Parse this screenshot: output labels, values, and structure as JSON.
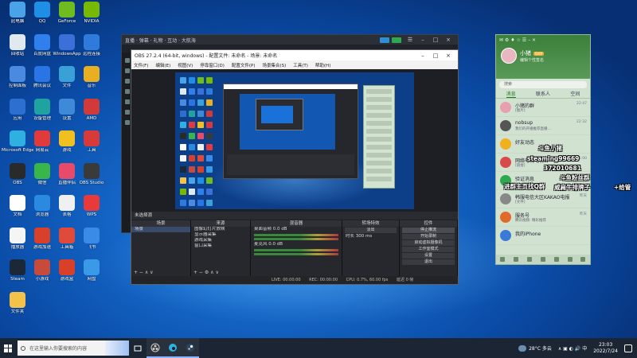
{
  "colors": {
    "accent": "#2fa84f",
    "desktop": "#1466c7",
    "taskbar": "#1c2533"
  },
  "desktop_icons": [
    {
      "label": "此电脑",
      "icon": "computer-icon",
      "color": "#4aa3e8"
    },
    {
      "label": "QQ",
      "icon": "qq-penguin-icon",
      "color": "#1f8fe6"
    },
    {
      "label": "GeForce",
      "icon": "geforce-icon",
      "color": "#6ebc1f"
    },
    {
      "label": "NVIDIA",
      "icon": "nvidia-icon",
      "color": "#76b900"
    },
    {
      "label": "回收站",
      "icon": "recycle-bin-icon",
      "color": "#e0e8f0"
    },
    {
      "label": "百度网盘",
      "icon": "baidu-netdisk-icon",
      "color": "#2f80ed"
    },
    {
      "label": "WindowsApp",
      "icon": "windows-app-icon",
      "color": "#3a70d8"
    },
    {
      "label": "远程连接",
      "icon": "remote-icon",
      "color": "#2e7bdc"
    },
    {
      "label": "控制面板",
      "icon": "control-panel-icon",
      "color": "#4a8ae0"
    },
    {
      "label": "腾讯会议",
      "icon": "tencent-meeting-icon",
      "color": "#2a75e5"
    },
    {
      "label": "文件",
      "icon": "file-icon",
      "color": "#3aa0d8"
    },
    {
      "label": "音乐",
      "icon": "music-icon",
      "color": "#e8b020"
    },
    {
      "label": "应用",
      "icon": "app-icon",
      "color": "#2c6fd1"
    },
    {
      "label": "设备管理",
      "icon": "device-manager-icon",
      "color": "#1ea3a0"
    },
    {
      "label": "设置",
      "icon": "settings-icon",
      "color": "#3f8ad8"
    },
    {
      "label": "AMD",
      "icon": "amd-icon",
      "color": "#d23a3a"
    },
    {
      "label": "Microsoft Edge",
      "icon": "edge-icon",
      "color": "#2fb0e0"
    },
    {
      "label": "网易云",
      "icon": "netease-music-icon",
      "color": "#e23a3a"
    },
    {
      "label": "游戏",
      "icon": "game-icon",
      "color": "#f0c020"
    },
    {
      "label": "工具",
      "icon": "tool-icon",
      "color": "#d83a3a"
    },
    {
      "label": "OBS",
      "icon": "obs-icon",
      "color": "#2a2a2a"
    },
    {
      "label": "微信",
      "icon": "wechat-icon",
      "color": "#3ab54a"
    },
    {
      "label": "直播伴侣",
      "icon": "live-icon",
      "color": "#e84a6a"
    },
    {
      "label": "OBS Studio",
      "icon": "obs-studio-icon",
      "color": "#3a3a3a"
    },
    {
      "label": "文档",
      "icon": "doc-icon",
      "color": "#ffffff"
    },
    {
      "label": "浏览器",
      "icon": "ie-icon",
      "color": "#2a8ae0"
    },
    {
      "label": "表格",
      "icon": "sheet-icon",
      "color": "#f0f0f0"
    },
    {
      "label": "WPS",
      "icon": "wps-icon",
      "color": "#e83a3a"
    },
    {
      "label": "播放器",
      "icon": "player-icon",
      "color": "#f5f5f5"
    },
    {
      "label": "游戏加速",
      "icon": "accelerator-icon",
      "color": "#d8402a"
    },
    {
      "label": "工具箱",
      "icon": "toolbox-icon",
      "color": "#e04a3a"
    },
    {
      "label": "飞书",
      "icon": "feishu-icon",
      "color": "#3a8ae8"
    },
    {
      "label": "Steam",
      "icon": "steam-icon",
      "color": "#1b2838"
    },
    {
      "label": "小游戏",
      "icon": "mini-game-icon",
      "color": "#c84a3a"
    },
    {
      "label": "游戏盒",
      "icon": "game-box-icon",
      "color": "#d8402a"
    },
    {
      "label": "网盘",
      "icon": "cloud-icon",
      "color": "#3a9ae8"
    },
    {
      "label": "文件夹",
      "icon": "folder-icon",
      "color": "#f3c24a"
    }
  ],
  "back_window": {
    "title": "直播 · 弹幕 · 礼物 · 互动 · 大航海"
  },
  "obs": {
    "title": "OBS 27.2.4 (64-bit, windows) - 配置文件: 未命名 - 场景: 未命名",
    "menu": [
      "文件(F)",
      "编辑(E)",
      "视图(V)",
      "停靠窗口(D)",
      "配置文件(P)",
      "场景集合(S)",
      "工具(T)",
      "帮助(H)"
    ],
    "source_bar": "未选择源",
    "panel_titles": {
      "scenes": "场景",
      "sources": "来源",
      "mixer": "混音器",
      "transitions": "转场特效",
      "controls": "控件"
    },
    "scenes": [
      "场景"
    ],
    "sources": [
      "图像幻灯片放映",
      "显示器采集",
      "游戏采集",
      "窗口采集"
    ],
    "mixer": [
      {
        "name": "桌面音频",
        "db": "0.0 dB"
      },
      {
        "name": "麦克风",
        "db": "0.0 dB"
      }
    ],
    "transition": {
      "type": "淡出",
      "duration_label": "时长",
      "duration": "300 ms"
    },
    "controls": [
      "停止推流",
      "开始录制",
      "启动虚拟摄像机",
      "工作室模式",
      "设置",
      "退出"
    ],
    "status": {
      "live": "LIVE: 00:00:00",
      "rec": "REC: 00:00:00",
      "cpu": "CPU: 0.7%, 60.00 fps",
      "net": "延迟 0 帧"
    }
  },
  "qq": {
    "nickname": "小猪",
    "vip": "SVIP",
    "signature": "编辑个性签名",
    "search_placeholder": "搜索",
    "tabs": [
      "消息",
      "联系人",
      "空间"
    ],
    "conversations": [
      {
        "name": "小猪的群",
        "msg": "[图片]",
        "time": "22:47",
        "color": "#e8a0b0"
      },
      {
        "name": "nobsup",
        "msg": "我们的开播推荐直播…",
        "time": "22:32",
        "color": "#555"
      },
      {
        "name": "好友动态",
        "msg": "",
        "time": "",
        "color": "#f0b020"
      },
      {
        "name": "网络电视电视台",
        "msg": "[链接]",
        "time": "21:00",
        "color": "#d84a4a"
      },
      {
        "name": "验证消息",
        "msg": "",
        "time": "",
        "color": "#2fa84f"
      },
      {
        "name": "韩服电信大区KAKAO电报",
        "msg": "[文件]",
        "time": "昨天",
        "color": "#888"
      },
      {
        "name": "服务号",
        "msg": "腾讯视频: 精彩推荐",
        "time": "昨天",
        "color": "#e06a2a"
      },
      {
        "name": "我的iPhone",
        "msg": "",
        "time": "",
        "color": "#3a7ad8"
      }
    ]
  },
  "danmaku": [
    {
      "text": "斗鱼小猪",
      "color": "#ff3a3a"
    },
    {
      "text": "steaming99669",
      "color": "#ff8ad8"
    },
    {
      "text": "372010681",
      "color": "#ffe23a"
    },
    {
      "text": "斗鱼粉丝群",
      "color": "#ff3a3a"
    },
    {
      "text": "进群主页找Q群",
      "color": "#ff8a3a"
    },
    {
      "text": "威扁牛排牌子",
      "color": "#ffd23a"
    },
    {
      "text": "+给管",
      "color": "#3aff7a"
    }
  ],
  "taskbar": {
    "search_placeholder": "在这里输入你要搜索的内容",
    "weather": "28°C 多云",
    "time": "23:03",
    "date": "2022/7/24",
    "apps": [
      "task-view-icon",
      "obs-icon",
      "edge-icon",
      "steam-icon"
    ]
  }
}
